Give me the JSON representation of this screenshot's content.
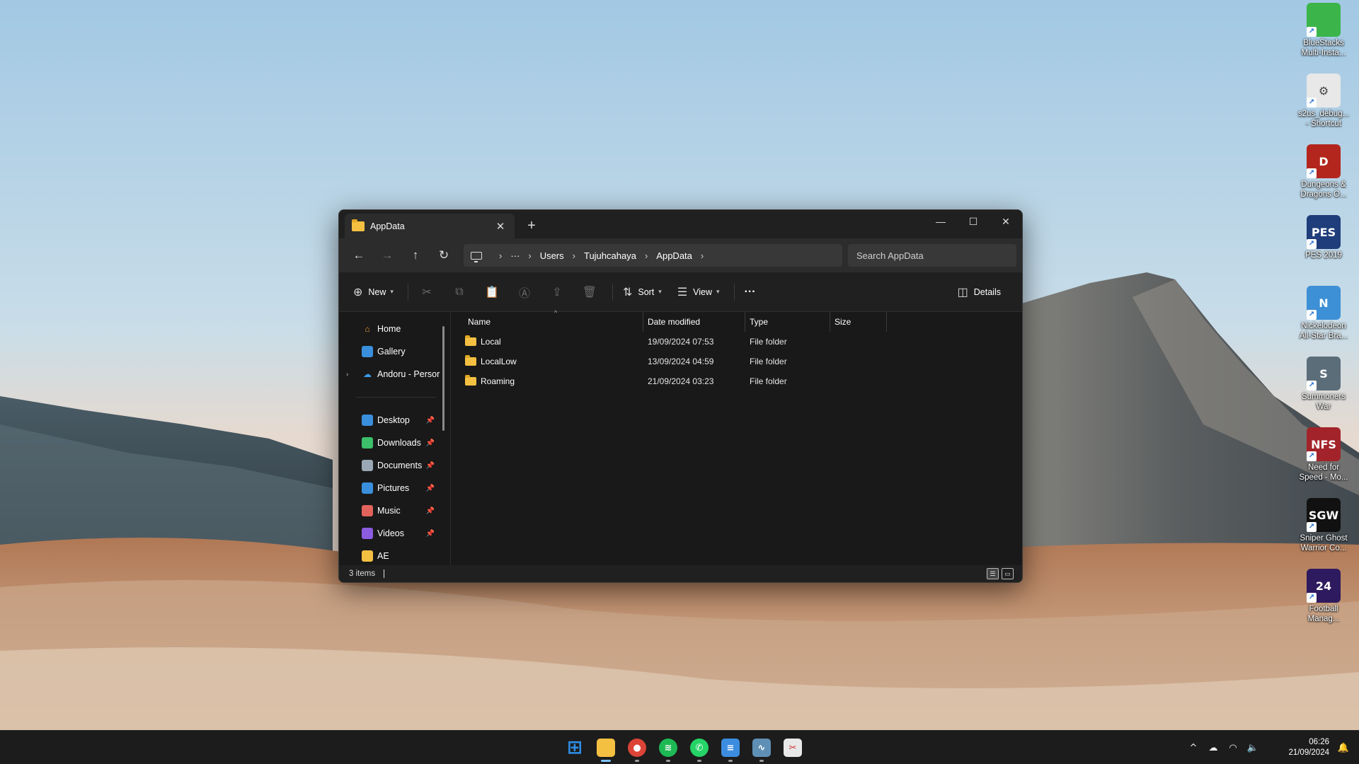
{
  "desktop": {
    "icons": [
      {
        "label": "BlueStacks\nMulti-Insta...",
        "glyph": "",
        "color": "#3bb54a",
        "icon": "bluestacks-icon"
      },
      {
        "label": "s2us_debug...\n- Shortcut",
        "glyph": "⚙",
        "color": "#e8e8e8",
        "icon": "settings-shortcut-icon"
      },
      {
        "label": "Dungeons &\nDragons O...",
        "glyph": "D",
        "color": "#b3261e",
        "icon": "dungeons-dragons-icon"
      },
      {
        "label": "PES 2019",
        "glyph": "PES",
        "color": "#1f3d7a",
        "icon": "pes-2019-icon"
      },
      {
        "label": "Nickelodeon\nAll-Star Bra...",
        "glyph": "N",
        "color": "#3d8fd6",
        "icon": "nickelodeon-icon"
      },
      {
        "label": "Summoners\nWar",
        "glyph": "S",
        "color": "#5c6d7a",
        "icon": "summoners-war-icon"
      },
      {
        "label": "Need for\nSpeed - Mo...",
        "glyph": "NFS",
        "color": "#a3232a",
        "icon": "need-for-speed-icon"
      },
      {
        "label": "Sniper Ghost\nWarrior Co...",
        "glyph": "SGW",
        "color": "#111111",
        "icon": "sniper-ghost-warrior-icon"
      },
      {
        "label": "Football\nManag...",
        "glyph": "24",
        "color": "#2e1a5e",
        "icon": "football-manager-icon"
      }
    ]
  },
  "window": {
    "tab_title": "AppData",
    "tab_close": "✕",
    "new_tab": "+",
    "controls": {
      "minimize": "—",
      "maximize": "☐",
      "close": "✕"
    },
    "nav": {
      "back": "←",
      "forward": "→",
      "up": "↑",
      "refresh": "↻"
    },
    "address": {
      "more": "···",
      "crumbs": [
        "Users",
        "Tujuhcahaya",
        "AppData"
      ],
      "separator": "›"
    },
    "search_placeholder": "Search AppData",
    "toolbar": {
      "new_label": "New",
      "sort_label": "Sort",
      "view_label": "View",
      "more": "···",
      "details_label": "Details"
    },
    "sidebar": {
      "quick": [
        {
          "label": "Home",
          "icon": "home-icon"
        },
        {
          "label": "Gallery",
          "icon": "gallery-icon"
        },
        {
          "label": "Andoru - Persor",
          "icon": "onedrive-icon"
        }
      ],
      "pinned": [
        {
          "label": "Desktop",
          "icon": "desktop-folder-icon",
          "color": "#3a8fdc"
        },
        {
          "label": "Downloads",
          "icon": "downloads-icon",
          "color": "#3bbf6a"
        },
        {
          "label": "Documents",
          "icon": "documents-icon",
          "color": "#9aa7b5"
        },
        {
          "label": "Pictures",
          "icon": "pictures-icon",
          "color": "#3a8fdc"
        },
        {
          "label": "Music",
          "icon": "music-icon",
          "color": "#e2635b"
        },
        {
          "label": "Videos",
          "icon": "videos-icon",
          "color": "#8c5ce0"
        },
        {
          "label": "AE",
          "icon": "folder-icon",
          "color": "#f4c042"
        }
      ]
    },
    "columns": {
      "name": "Name",
      "date": "Date modified",
      "type": "Type",
      "size": "Size"
    },
    "files": [
      {
        "name": "Local",
        "date": "19/09/2024 07:53",
        "type": "File folder"
      },
      {
        "name": "LocalLow",
        "date": "13/09/2024 04:59",
        "type": "File folder"
      },
      {
        "name": "Roaming",
        "date": "21/09/2024 03:23",
        "type": "File folder"
      }
    ],
    "status": "3 items"
  },
  "taskbar": {
    "apps": [
      {
        "name": "start",
        "glyph": "⊞",
        "color": "#2f8fe8",
        "active": false,
        "running": false
      },
      {
        "name": "file-explorer",
        "glyph": "",
        "color": "#f4c042",
        "active": true,
        "running": true
      },
      {
        "name": "chrome",
        "glyph": "●",
        "color": "#db4437",
        "active": false,
        "running": true
      },
      {
        "name": "spotify",
        "glyph": "≋",
        "color": "#1db954",
        "active": false,
        "running": true
      },
      {
        "name": "whatsapp",
        "glyph": "✆",
        "color": "#25d366",
        "active": false,
        "running": true
      },
      {
        "name": "notepad",
        "glyph": "≡",
        "color": "#3c8de0",
        "active": false,
        "running": true
      },
      {
        "name": "performance-monitor",
        "glyph": "∿",
        "color": "#5f8fb5",
        "active": false,
        "running": true
      },
      {
        "name": "snipping-tool",
        "glyph": "✂",
        "color": "#e8e8e8",
        "active": false,
        "running": false
      }
    ],
    "tray": {
      "chevron": "^",
      "cloud": "☁",
      "wifi": "◠",
      "volume": "🔈"
    },
    "time": "06:26",
    "date": "21/09/2024",
    "notification": "🔔"
  }
}
